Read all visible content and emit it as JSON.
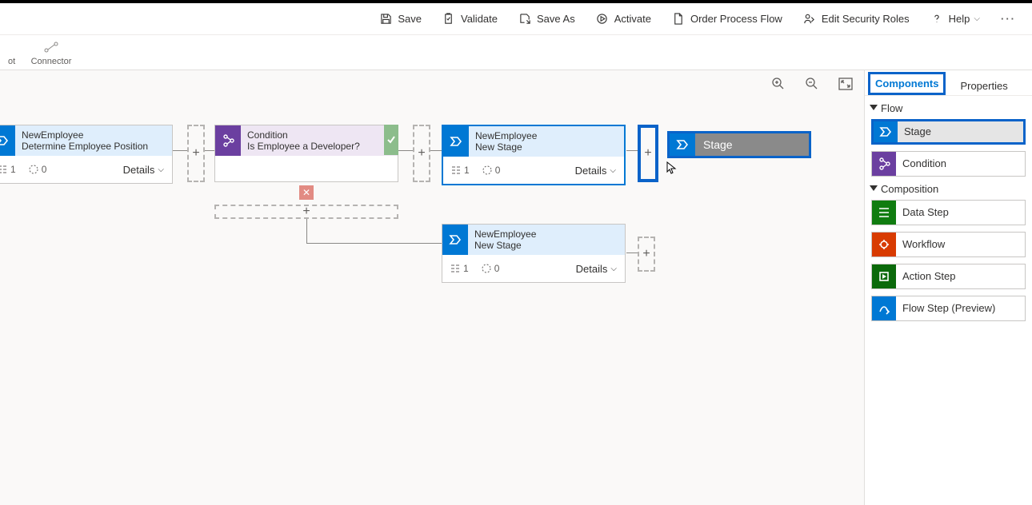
{
  "toolbar": {
    "save": "Save",
    "validate": "Validate",
    "save_as": "Save As",
    "activate": "Activate",
    "order": "Order Process Flow",
    "security": "Edit Security Roles",
    "help": "Help"
  },
  "subbar": {
    "connector": "Connector",
    "snapshot": "ot"
  },
  "panel": {
    "tab_components": "Components",
    "tab_properties": "Properties",
    "section_flow": "Flow",
    "section_composition": "Composition",
    "items": {
      "stage": "Stage",
      "condition": "Condition",
      "data_step": "Data Step",
      "workflow": "Workflow",
      "action_step": "Action Step",
      "flow_step": "Flow Step (Preview)"
    }
  },
  "canvas": {
    "stage1": {
      "entity": "NewEmployee",
      "name": "Determine Employee Position",
      "steps": "1",
      "dur": "0",
      "details": "Details"
    },
    "cond": {
      "title": "Condition",
      "question": "Is Employee a Developer?"
    },
    "stage2": {
      "entity": "NewEmployee",
      "name": "New Stage",
      "steps": "1",
      "dur": "0",
      "details": "Details"
    },
    "stage3": {
      "entity": "NewEmployee",
      "name": "New Stage",
      "steps": "1",
      "dur": "0",
      "details": "Details"
    },
    "drag_label": "Stage"
  }
}
